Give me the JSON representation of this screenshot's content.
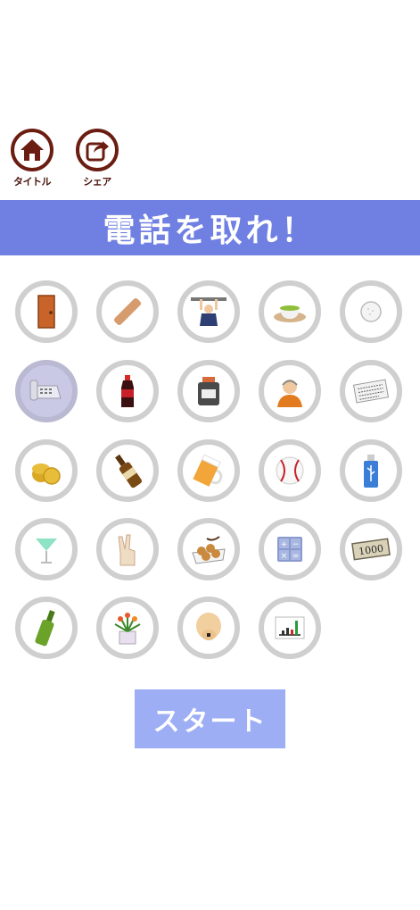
{
  "header": {
    "title_button_label": "タイトル",
    "share_button_label": "シェア"
  },
  "banner": {
    "title": "電話を取れ！"
  },
  "items": [
    {
      "icon": "door-icon",
      "selected": false
    },
    {
      "icon": "stick-icon",
      "selected": false
    },
    {
      "icon": "hanging-man-icon",
      "selected": false
    },
    {
      "icon": "tea-cup-icon",
      "selected": false
    },
    {
      "icon": "golf-ball-icon",
      "selected": false
    },
    {
      "icon": "telephone-icon",
      "selected": true
    },
    {
      "icon": "soda-bottle-icon",
      "selected": false
    },
    {
      "icon": "jar-icon",
      "selected": false
    },
    {
      "icon": "old-man-icon",
      "selected": false
    },
    {
      "icon": "newspaper-icon",
      "selected": false
    },
    {
      "icon": "coins-icon",
      "selected": false
    },
    {
      "icon": "beer-bottle-icon",
      "selected": false
    },
    {
      "icon": "beer-mug-icon",
      "selected": false
    },
    {
      "icon": "baseball-icon",
      "selected": false
    },
    {
      "icon": "usb-stick-icon",
      "selected": false
    },
    {
      "icon": "cocktail-icon",
      "selected": false
    },
    {
      "icon": "peace-hand-icon",
      "selected": false
    },
    {
      "icon": "takoyaki-icon",
      "selected": false
    },
    {
      "icon": "calculator-icon",
      "selected": false
    },
    {
      "icon": "banknote-icon",
      "selected": false
    },
    {
      "icon": "wine-bottle-icon",
      "selected": false
    },
    {
      "icon": "flower-pot-icon",
      "selected": false
    },
    {
      "icon": "bald-head-icon",
      "selected": false
    },
    {
      "icon": "bar-chart-icon",
      "selected": false
    }
  ],
  "banknote_text": "1000",
  "start_button": {
    "label": "スタート"
  },
  "colors": {
    "banner": "#6f7fe2",
    "start": "#9daef5",
    "icon_ring": "#cfcfcf",
    "brown": "#6b1d12"
  }
}
